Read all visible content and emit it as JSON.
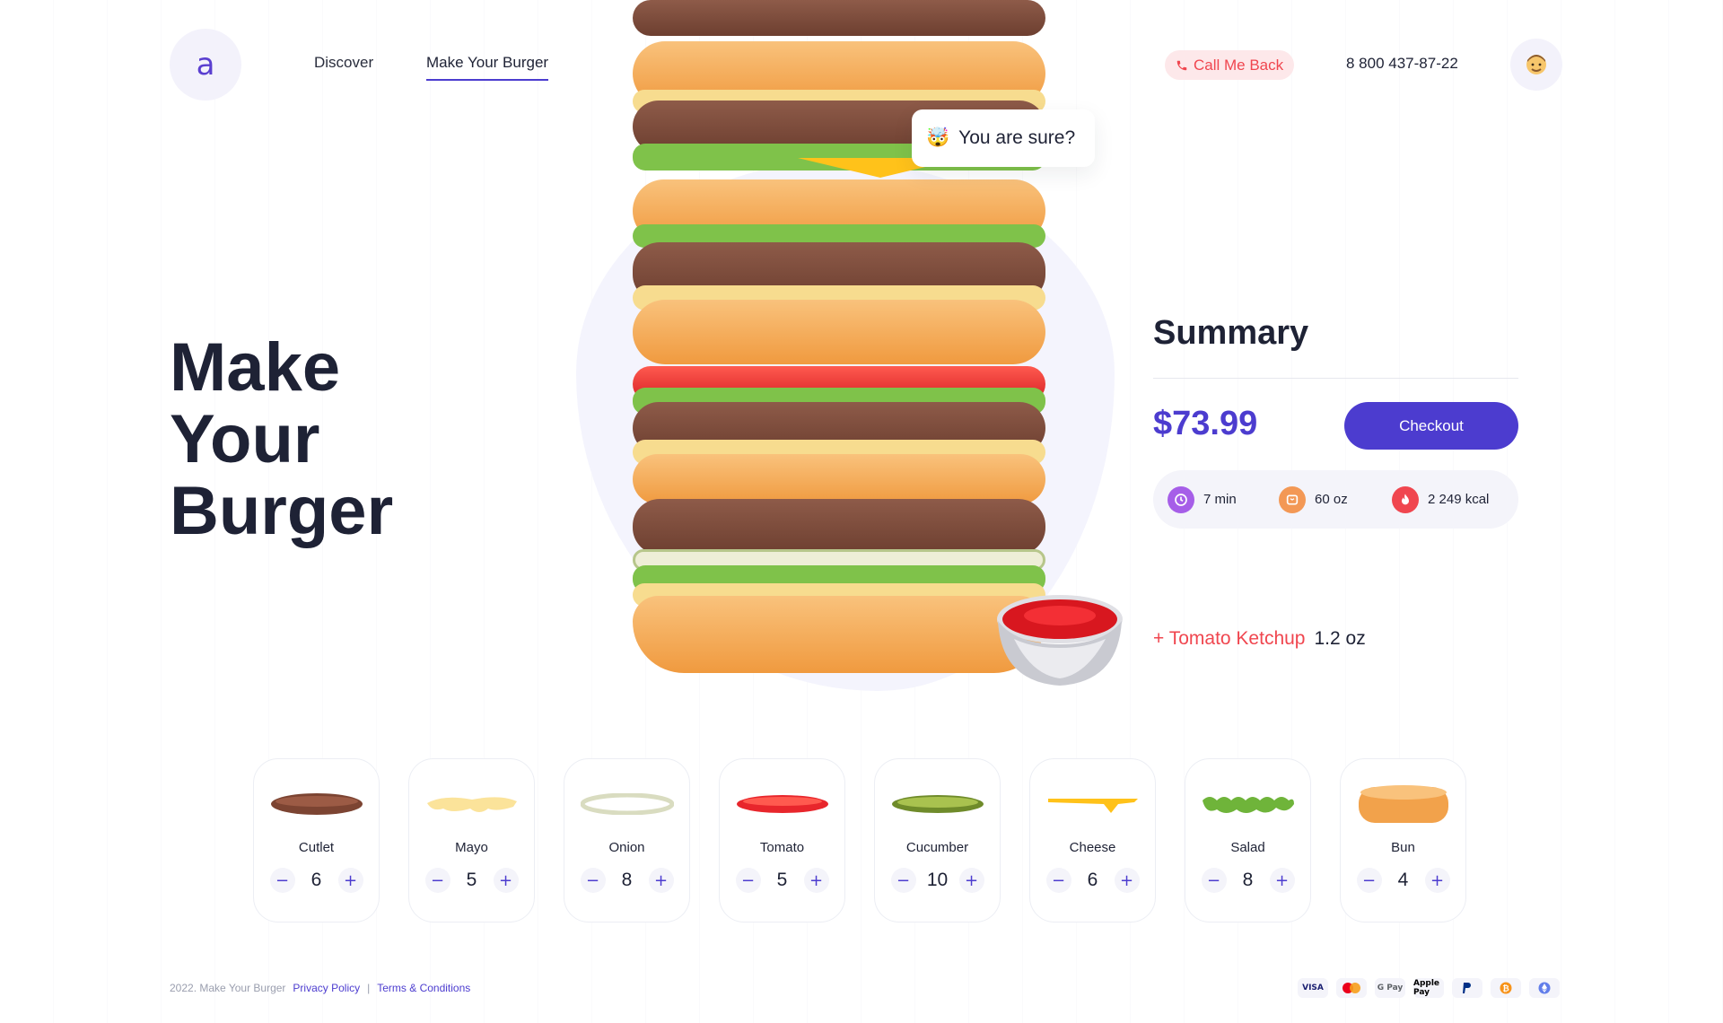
{
  "header": {
    "logo": "a",
    "nav": [
      {
        "label": "Discover"
      },
      {
        "label": "Make Your Burger"
      }
    ],
    "call_back": "Call Me Back",
    "phone": "8 800 437-87-22",
    "avatar_icon": "user-avatar-icon"
  },
  "hero": {
    "title": "Make Your Burger"
  },
  "tooltip": {
    "emoji": "🤯",
    "text": "You are sure?"
  },
  "summary": {
    "title": "Summary",
    "price": "$73.99",
    "checkout_label": "Checkout",
    "stats": {
      "time": "7 min",
      "weight": "60 oz",
      "calories": "2 249 kcal"
    },
    "added_item": {
      "name": "+ Tomato Ketchup",
      "qty": "1.2 oz"
    }
  },
  "ingredients": [
    {
      "name": "Cutlet",
      "qty": "6"
    },
    {
      "name": "Mayo",
      "qty": "5"
    },
    {
      "name": "Onion",
      "qty": "8"
    },
    {
      "name": "Tomato",
      "qty": "5"
    },
    {
      "name": "Cucumber",
      "qty": "10"
    },
    {
      "name": "Cheese",
      "qty": "6"
    },
    {
      "name": "Salad",
      "qty": "8"
    },
    {
      "name": "Bun",
      "qty": "4"
    }
  ],
  "footer": {
    "copyright": "2022. Make Your Burger",
    "privacy": "Privacy Policy",
    "separator": "|",
    "terms": "Terms & Conditions"
  },
  "payments": [
    "VISA",
    "Mastercard",
    "G Pay",
    "Apple Pay",
    "PayPal",
    "Bitcoin",
    "Ethereum"
  ],
  "colors": {
    "accent": "#4c3ccf",
    "red": "#f0464f",
    "dark": "#1e2235"
  }
}
